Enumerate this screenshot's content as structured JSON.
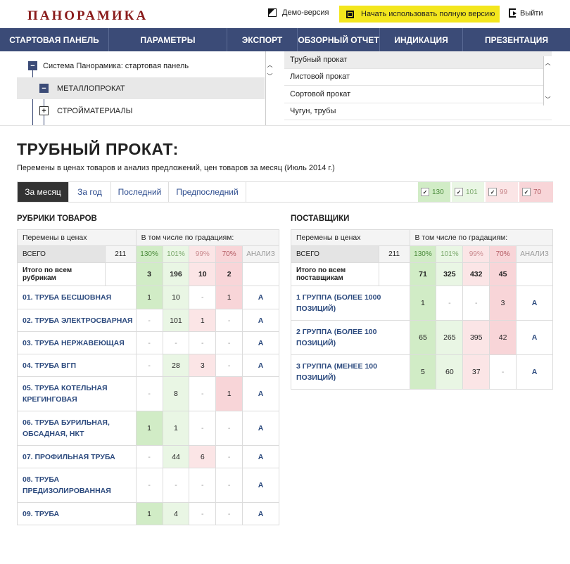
{
  "brand": "ПАНОРАМИКА",
  "demo_label": "Демо-версия",
  "full_label": "Начать использовать полную версию",
  "exit_label": "Выйти",
  "nav": [
    "СТАРТОВАЯ ПАНЕЛЬ",
    "ПАРАМЕТРЫ",
    "ЭКСПОРТ",
    "ОБЗОРНЫЙ ОТЧЕТ",
    "ИНДИКАЦИЯ",
    "ПРЕЗЕНТАЦИЯ"
  ],
  "tree": [
    {
      "label": "Система Панорамика: стартовая панель",
      "sym": "−"
    },
    {
      "label": "МЕТАЛЛОПРОКАТ",
      "sym": "−"
    },
    {
      "label": "СТРОЙМАТЕРИАЛЫ",
      "sym": "+"
    }
  ],
  "list": [
    "Трубный прокат",
    "Листовой прокат",
    "Сортовой прокат",
    "Чугун, трубы"
  ],
  "title": "ТРУБНЫЙ ПРОКАТ:",
  "subtitle": "Перемены в ценах товаров и анализ предложений, цен товаров за месяц (Июль 2014 г.)",
  "tabs": [
    "За месяц",
    "За год",
    "Последний",
    "Предпоследний"
  ],
  "filters": [
    "130",
    "101",
    "99",
    "70"
  ],
  "colors": {
    "g1": "#d1ecc6",
    "g2": "#e9f6e4",
    "r1": "#fbe5e6",
    "r2": "#f8d5d8",
    "nav": "#3b4b77",
    "accent": "#f3e61d"
  },
  "left": {
    "section": "РУБРИКИ ТОВАРОВ",
    "h1": "Перемены в ценах",
    "h2": "В том числе по градациям:",
    "total_label": "ВСЕГО",
    "total": "211",
    "grads": [
      "130%",
      "101%",
      "99%",
      "70%"
    ],
    "analysis": "АНАЛИЗ",
    "sum_label": "Итого по всем рубрикам",
    "sum": [
      "3",
      "196",
      "10",
      "2"
    ],
    "rows": [
      {
        "name": "01. ТРУБА БЕСШОВНАЯ",
        "v": [
          "1",
          "10",
          "-",
          "1"
        ],
        "a": "А"
      },
      {
        "name": "02. ТРУБА ЭЛЕКТРОСВАРНАЯ",
        "v": [
          "-",
          "101",
          "1",
          "-"
        ],
        "a": "А"
      },
      {
        "name": "03. ТРУБА НЕРЖАВЕЮЩАЯ",
        "v": [
          "-",
          "-",
          "-",
          "-"
        ],
        "a": "А"
      },
      {
        "name": "04. ТРУБА ВГП",
        "v": [
          "-",
          "28",
          "3",
          "-"
        ],
        "a": "А"
      },
      {
        "name": "05. ТРУБА КОТЕЛЬНАЯ КРЕГИНГОВАЯ",
        "v": [
          "-",
          "8",
          "-",
          "1"
        ],
        "a": "А"
      },
      {
        "name": "06. ТРУБА БУРИЛЬНАЯ, ОБСАДНАЯ, НКТ",
        "v": [
          "1",
          "1",
          "-",
          "-"
        ],
        "a": "А"
      },
      {
        "name": "07. ПРОФИЛЬНАЯ ТРУБА",
        "v": [
          "-",
          "44",
          "6",
          "-"
        ],
        "a": "А"
      },
      {
        "name": "08. ТРУБА ПРЕДИЗОЛИРОВАННАЯ",
        "v": [
          "-",
          "-",
          "-",
          "-"
        ],
        "a": "А"
      },
      {
        "name": "09. ТРУБА",
        "v": [
          "1",
          "4",
          "-",
          "-"
        ],
        "a": "А"
      }
    ]
  },
  "right": {
    "section": "ПОСТАВЩИКИ",
    "h1": "Перемены в ценах",
    "h2": "В том числе по градациям:",
    "total_label": "ВСЕГО",
    "total": "211",
    "grads": [
      "130%",
      "101%",
      "99%",
      "70%"
    ],
    "analysis": "АНАЛИЗ",
    "sum_label": "Итого по всем поставщикам",
    "sum": [
      "71",
      "325",
      "432",
      "45"
    ],
    "rows": [
      {
        "name": "1 ГРУППА (БОЛЕЕ 1000 ПОЗИЦИЙ)",
        "v": [
          "1",
          "-",
          "-",
          "3"
        ],
        "a": "А"
      },
      {
        "name": "2 ГРУППА (БОЛЕЕ 100 ПОЗИЦИЙ)",
        "v": [
          "65",
          "265",
          "395",
          "42"
        ],
        "a": "А"
      },
      {
        "name": "3 ГРУППА (МЕНЕЕ 100 ПОЗИЦИЙ)",
        "v": [
          "5",
          "60",
          "37",
          "-"
        ],
        "a": "А"
      }
    ]
  }
}
